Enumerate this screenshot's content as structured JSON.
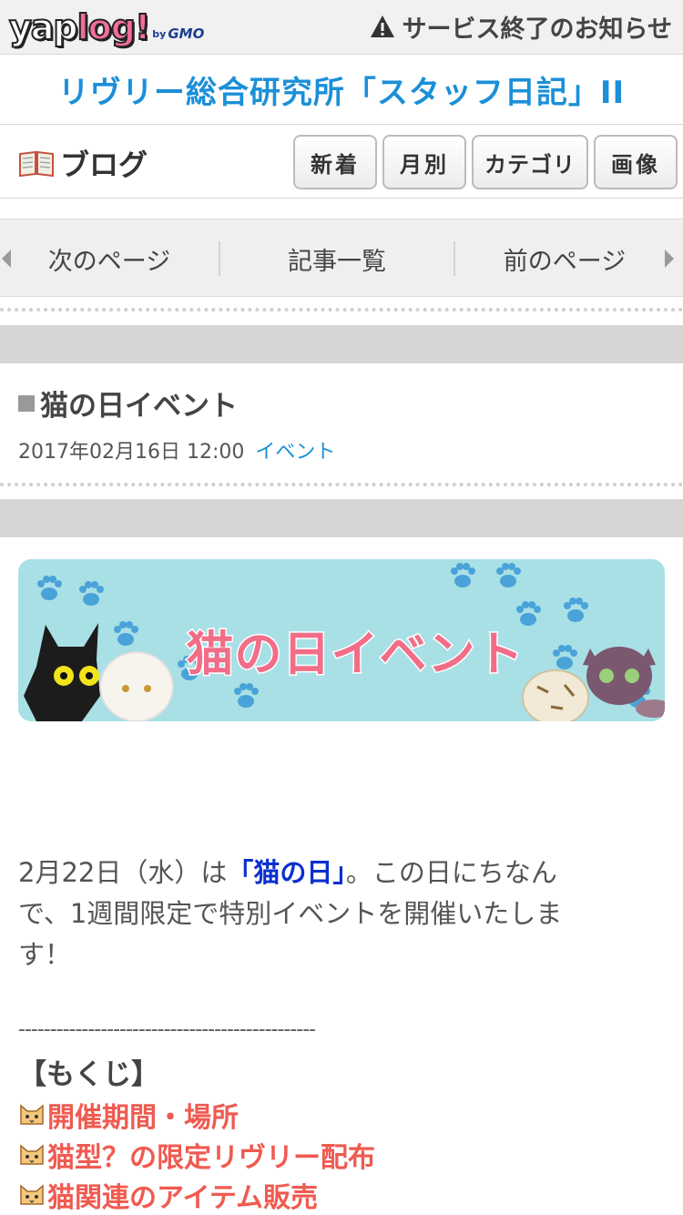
{
  "header": {
    "logo": {
      "part1": "yap",
      "part2": "log!",
      "by": "by",
      "company": "GMO"
    },
    "notice": "サービス終了のお知らせ"
  },
  "blog": {
    "title": "リヴリー総合研究所「スタッフ日記」II",
    "label": "ブログ",
    "buttons": [
      "新着",
      "月別",
      "カテゴリ",
      "画像"
    ]
  },
  "pager": {
    "next": "次のページ",
    "list": "記事一覧",
    "prev": "前のページ"
  },
  "entry": {
    "title": "猫の日イベント",
    "date": "2017年02月16日 12:00",
    "category": "イベント",
    "banner_text": "猫の日イベント",
    "body": {
      "line1_pre": "2月22日（水）は",
      "line1_hl": "「猫の日」",
      "line1_post": "。この日にちなん",
      "line2": "で、1週間限定で特別イベントを開催いたしま",
      "line3": "す！"
    },
    "divider": "-----------------------------------------------",
    "toc_title": "【もくじ】",
    "toc": [
      "開催期間・場所",
      "猫型？の限定リヴリー配布",
      "猫関連のアイテム販売"
    ]
  },
  "colors": {
    "accent_blue": "#1b8fd8",
    "toc_red": "#f05a50",
    "highlight_blue": "#0a2fd0",
    "banner_bg": "#a8e0e6"
  },
  "icons": [
    "warning-icon",
    "book-icon",
    "arrow-left-icon",
    "arrow-right-icon",
    "cat-face-icon",
    "paw-icon"
  ]
}
